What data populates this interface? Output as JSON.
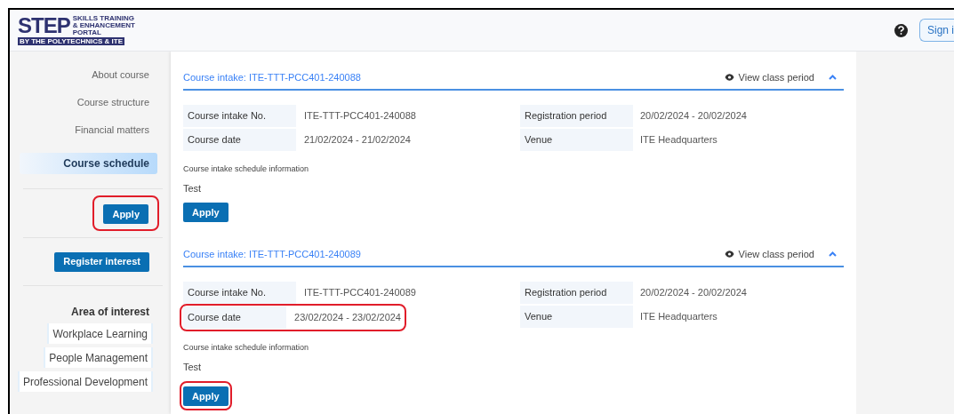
{
  "header": {
    "logo": {
      "wordmark": "STEP",
      "tagline": [
        "SKILLS TRAINING",
        "& ENHANCEMENT",
        "PORTAL"
      ],
      "strap": "BY THE POLYTECHNICS & ITE"
    },
    "sign_in": "Sign i"
  },
  "sidebar": {
    "items": [
      {
        "label": "About course",
        "selected": false
      },
      {
        "label": "Course structure",
        "selected": false
      },
      {
        "label": "Financial matters",
        "selected": false
      },
      {
        "label": "Course schedule",
        "selected": true
      }
    ],
    "apply_button": {
      "label": "Apply",
      "annotated": true
    },
    "register_button": {
      "label": "Register interest"
    },
    "area_of_interest": {
      "title": "Area of interest",
      "tags": [
        "Workplace Learning",
        "People Management",
        "Professional Development"
      ]
    }
  },
  "intakes": [
    {
      "title": "Course intake: ITE-TTT-PCC401-240088",
      "view_label": "View class period",
      "fields": [
        {
          "label": "Course intake No.",
          "value": "ITE-TTT-PCC401-240088",
          "annotated": false
        },
        {
          "label": "Course date",
          "value": "21/02/2024 - 21/02/2024",
          "annotated": false
        }
      ],
      "fields_right": [
        {
          "label": "Registration period",
          "value": "20/02/2024 - 20/02/2024"
        },
        {
          "label": "Venue",
          "value": "ITE Headquarters"
        }
      ],
      "info_label": "Course intake schedule information",
      "info": "Test",
      "apply": {
        "label": "Apply",
        "annotated": false
      }
    },
    {
      "title": "Course intake: ITE-TTT-PCC401-240089",
      "view_label": "View class period",
      "fields": [
        {
          "label": "Course intake No.",
          "value": "ITE-TTT-PCC401-240089",
          "annotated": false
        },
        {
          "label": "Course date",
          "value": "23/02/2024 - 23/02/2024",
          "annotated": true
        }
      ],
      "fields_right": [
        {
          "label": "Registration period",
          "value": "20/02/2024 - 20/02/2024"
        },
        {
          "label": "Venue",
          "value": "ITE Headquarters"
        }
      ],
      "info_label": "Course intake schedule information",
      "info": "Test",
      "apply": {
        "label": "Apply",
        "annotated": true
      }
    }
  ]
}
